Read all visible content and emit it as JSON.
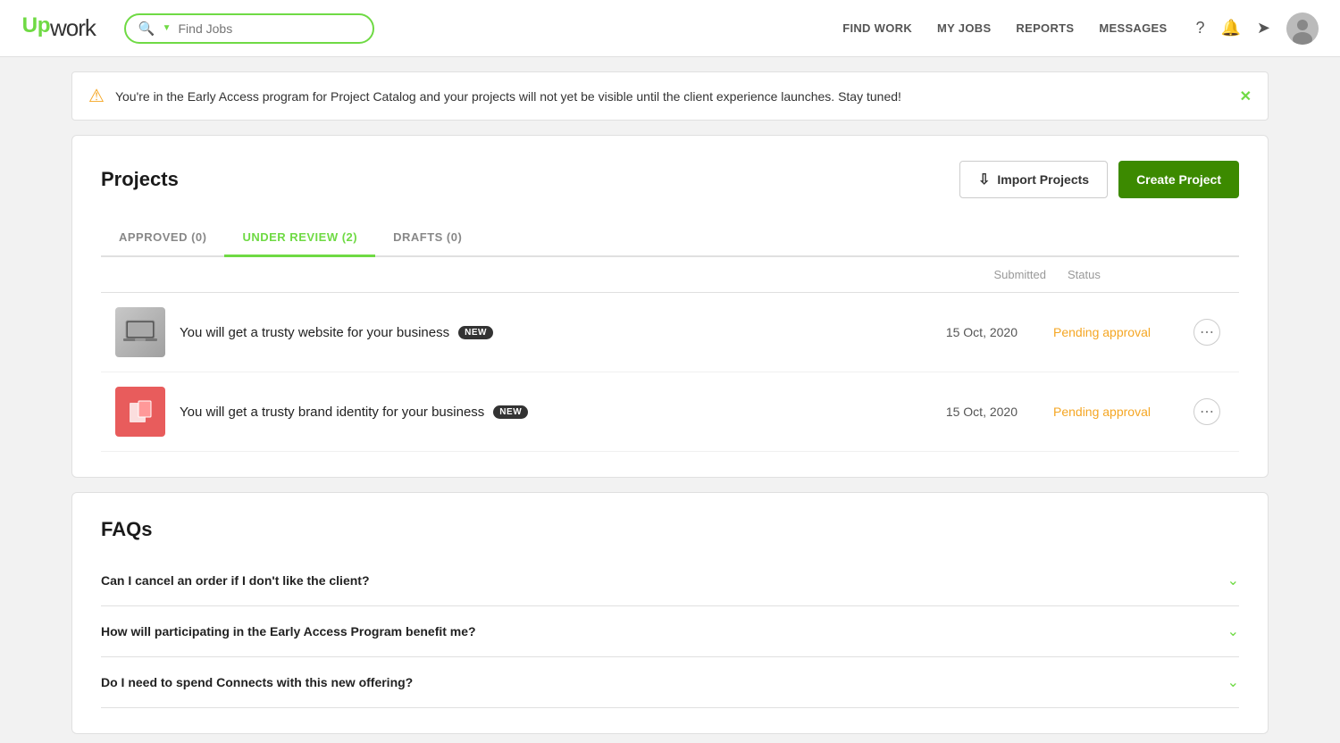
{
  "navbar": {
    "logo_up": "Up",
    "logo_work": "work",
    "search_placeholder": "Find Jobs",
    "nav_links": [
      {
        "label": "FIND WORK",
        "key": "find-work"
      },
      {
        "label": "MY JOBS",
        "key": "my-jobs"
      },
      {
        "label": "REPORTS",
        "key": "reports"
      },
      {
        "label": "MESSAGES",
        "key": "messages"
      }
    ]
  },
  "banner": {
    "text": "You're in the Early Access program for Project Catalog and your projects will not yet be visible until the client experience launches. Stay tuned!"
  },
  "projects": {
    "title": "Projects",
    "import_label": "Import Projects",
    "create_label": "Create Project",
    "tabs": [
      {
        "label": "APPROVED (0)",
        "key": "approved"
      },
      {
        "label": "UNDER REVIEW (2)",
        "key": "under-review",
        "active": true
      },
      {
        "label": "DRAFTS (0)",
        "key": "drafts"
      }
    ],
    "table_headers": {
      "submitted": "Submitted",
      "status": "Status"
    },
    "projects": [
      {
        "name": "You will get a trusty website for your business",
        "badge": "NEW",
        "submitted": "15 Oct, 2020",
        "status": "Pending approval",
        "thumb_type": "laptop"
      },
      {
        "name": "You will get a trusty brand identity for your business",
        "badge": "NEW",
        "submitted": "15 Oct, 2020",
        "status": "Pending approval",
        "thumb_type": "brand"
      }
    ]
  },
  "faqs": {
    "title": "FAQs",
    "items": [
      {
        "question": "Can I cancel an order if I don't like the client?"
      },
      {
        "question": "How will participating in the Early Access Program benefit me?"
      },
      {
        "question": "Do I need to spend Connects with this new offering?"
      }
    ]
  }
}
